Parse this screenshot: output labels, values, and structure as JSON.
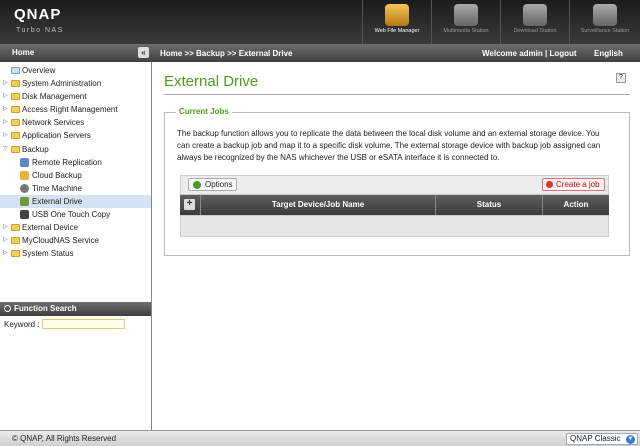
{
  "header": {
    "logo": "QNAP",
    "logo_sub": "Turbo NAS",
    "apps": [
      {
        "label": "Web File Manager"
      },
      {
        "label": "Multimedia Station"
      },
      {
        "label": "Download Station"
      },
      {
        "label": "Surveillance Station"
      }
    ]
  },
  "topbar": {
    "home_label": "Home",
    "collapse_glyph": "«",
    "breadcrumb": "Home >> Backup >> External Drive",
    "welcome": "Welcome admin | Logout",
    "language": "English"
  },
  "sidebar": {
    "items": [
      {
        "label": "Overview"
      },
      {
        "label": "System Administration"
      },
      {
        "label": "Disk Management"
      },
      {
        "label": "Access Right Management"
      },
      {
        "label": "Network Services"
      },
      {
        "label": "Application Servers"
      },
      {
        "label": "Backup"
      },
      {
        "label": "Remote Replication"
      },
      {
        "label": "Cloud Backup"
      },
      {
        "label": "Time Machine"
      },
      {
        "label": "External Drive"
      },
      {
        "label": "USB One Touch Copy"
      },
      {
        "label": "External Device"
      },
      {
        "label": "MyCloudNAS Service"
      },
      {
        "label": "System Status"
      }
    ]
  },
  "function_search": {
    "title": "Function Search",
    "keyword_label": "Keyword :",
    "keyword_value": ""
  },
  "main": {
    "title": "External Drive",
    "help_glyph": "?",
    "section_title": "Current Jobs",
    "description": "The backup function allows you to replicate the data between the local disk volume and an external storage device. You can create a backup job and map it to a specific disk volume. The external storage device with backup job assigned can always be recognized by the NAS whichever the USB or eSATA interface it is connected to.",
    "options_label": "Options",
    "create_label": "Create a job",
    "table": {
      "expand_glyph": "+",
      "columns": [
        "Target Device/Job Name",
        "Status",
        "Action"
      ]
    }
  },
  "footer": {
    "copyright": "© QNAP, All Rights Reserved",
    "theme": "QNAP Classic"
  }
}
